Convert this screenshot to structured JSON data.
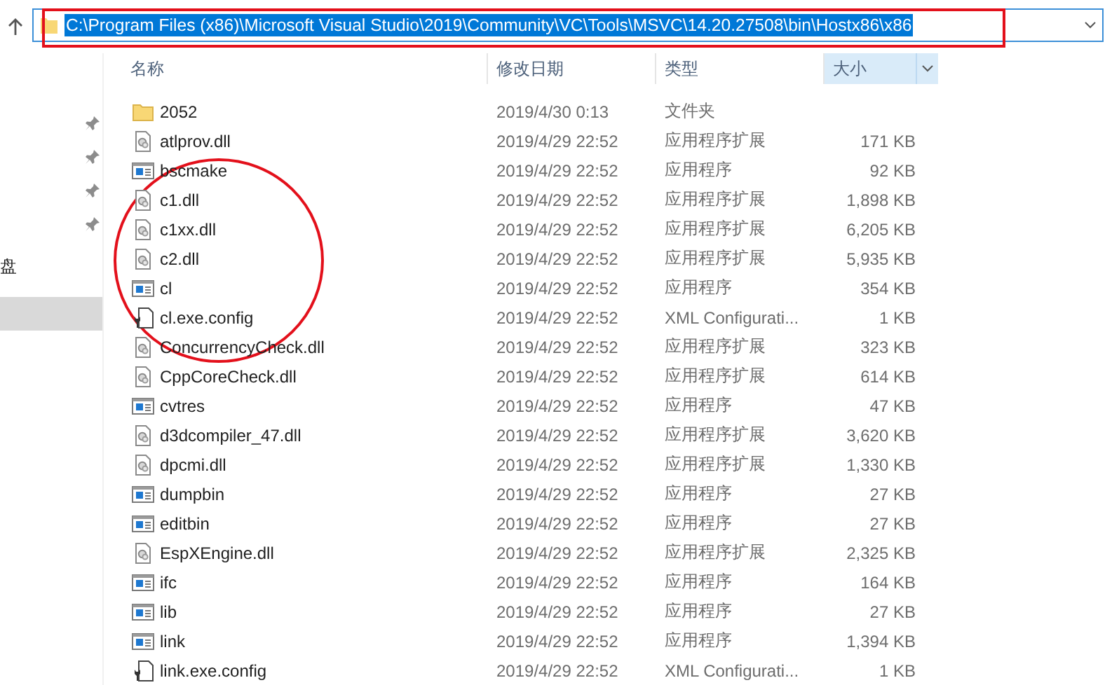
{
  "address_bar": {
    "value": "C:\\Program Files (x86)\\Microsoft Visual Studio\\2019\\Community\\VC\\Tools\\MSVC\\14.20.27508\\bin\\Hostx86\\x86",
    "selected": true
  },
  "sidebar": {
    "items": [
      {
        "kind": "pinned",
        "selected": false
      },
      {
        "kind": "pinned",
        "selected": false
      },
      {
        "kind": "pinned",
        "selected": false
      },
      {
        "kind": "pinned",
        "selected": false
      },
      {
        "kind": "label",
        "label": "盘",
        "selected": false
      },
      {
        "kind": "blank",
        "selected": true
      }
    ]
  },
  "table": {
    "columns": [
      {
        "label": "名称",
        "selected": false
      },
      {
        "label": "修改日期",
        "selected": false
      },
      {
        "label": "类型",
        "selected": false
      },
      {
        "label": "大小",
        "selected": true
      }
    ],
    "rows": [
      {
        "kind": "folder",
        "name": "2052",
        "date": "2019/4/30 0:13",
        "type": "文件夹"
      },
      {
        "kind": "dll",
        "name": "atlprov.dll",
        "date": "2019/4/29 22:52",
        "type": "应用程序扩展",
        "size": "171 KB"
      },
      {
        "kind": "exe",
        "name": "bscmake",
        "date": "2019/4/29 22:52",
        "type": "应用程序",
        "size": "92 KB"
      },
      {
        "kind": "dll",
        "name": "c1.dll",
        "date": "2019/4/29 22:52",
        "type": "应用程序扩展",
        "size": "1,898 KB"
      },
      {
        "kind": "dll",
        "name": "c1xx.dll",
        "date": "2019/4/29 22:52",
        "type": "应用程序扩展",
        "size": "6,205 KB"
      },
      {
        "kind": "dll",
        "name": "c2.dll",
        "date": "2019/4/29 22:52",
        "type": "应用程序扩展",
        "size": "5,935 KB"
      },
      {
        "kind": "exe",
        "name": "cl",
        "date": "2019/4/29 22:52",
        "type": "应用程序",
        "size": "354 KB"
      },
      {
        "kind": "config",
        "name": "cl.exe.config",
        "date": "2019/4/29 22:52",
        "type": "XML Configurati...",
        "size": "1 KB"
      },
      {
        "kind": "dll",
        "name": "ConcurrencyCheck.dll",
        "date": "2019/4/29 22:52",
        "type": "应用程序扩展",
        "size": "323 KB"
      },
      {
        "kind": "dll",
        "name": "CppCoreCheck.dll",
        "date": "2019/4/29 22:52",
        "type": "应用程序扩展",
        "size": "614 KB"
      },
      {
        "kind": "exe",
        "name": "cvtres",
        "date": "2019/4/29 22:52",
        "type": "应用程序",
        "size": "47 KB"
      },
      {
        "kind": "dll",
        "name": "d3dcompiler_47.dll",
        "date": "2019/4/29 22:52",
        "type": "应用程序扩展",
        "size": "3,620 KB"
      },
      {
        "kind": "dll",
        "name": "dpcmi.dll",
        "date": "2019/4/29 22:52",
        "type": "应用程序扩展",
        "size": "1,330 KB"
      },
      {
        "kind": "exe",
        "name": "dumpbin",
        "date": "2019/4/29 22:52",
        "type": "应用程序",
        "size": "27 KB"
      },
      {
        "kind": "exe",
        "name": "editbin",
        "date": "2019/4/29 22:52",
        "type": "应用程序",
        "size": "27 KB"
      },
      {
        "kind": "dll",
        "name": "EspXEngine.dll",
        "date": "2019/4/29 22:52",
        "type": "应用程序扩展",
        "size": "2,325 KB"
      },
      {
        "kind": "exe",
        "name": "ifc",
        "date": "2019/4/29 22:52",
        "type": "应用程序",
        "size": "164 KB"
      },
      {
        "kind": "exe",
        "name": "lib",
        "date": "2019/4/29 22:52",
        "type": "应用程序",
        "size": "27 KB"
      },
      {
        "kind": "exe",
        "name": "link",
        "date": "2019/4/29 22:52",
        "type": "应用程序",
        "size": "1,394 KB"
      },
      {
        "kind": "config",
        "name": "link.exe.config",
        "date": "2019/4/29 22:52",
        "type": "XML Configurati...",
        "size": "1 KB"
      }
    ]
  }
}
